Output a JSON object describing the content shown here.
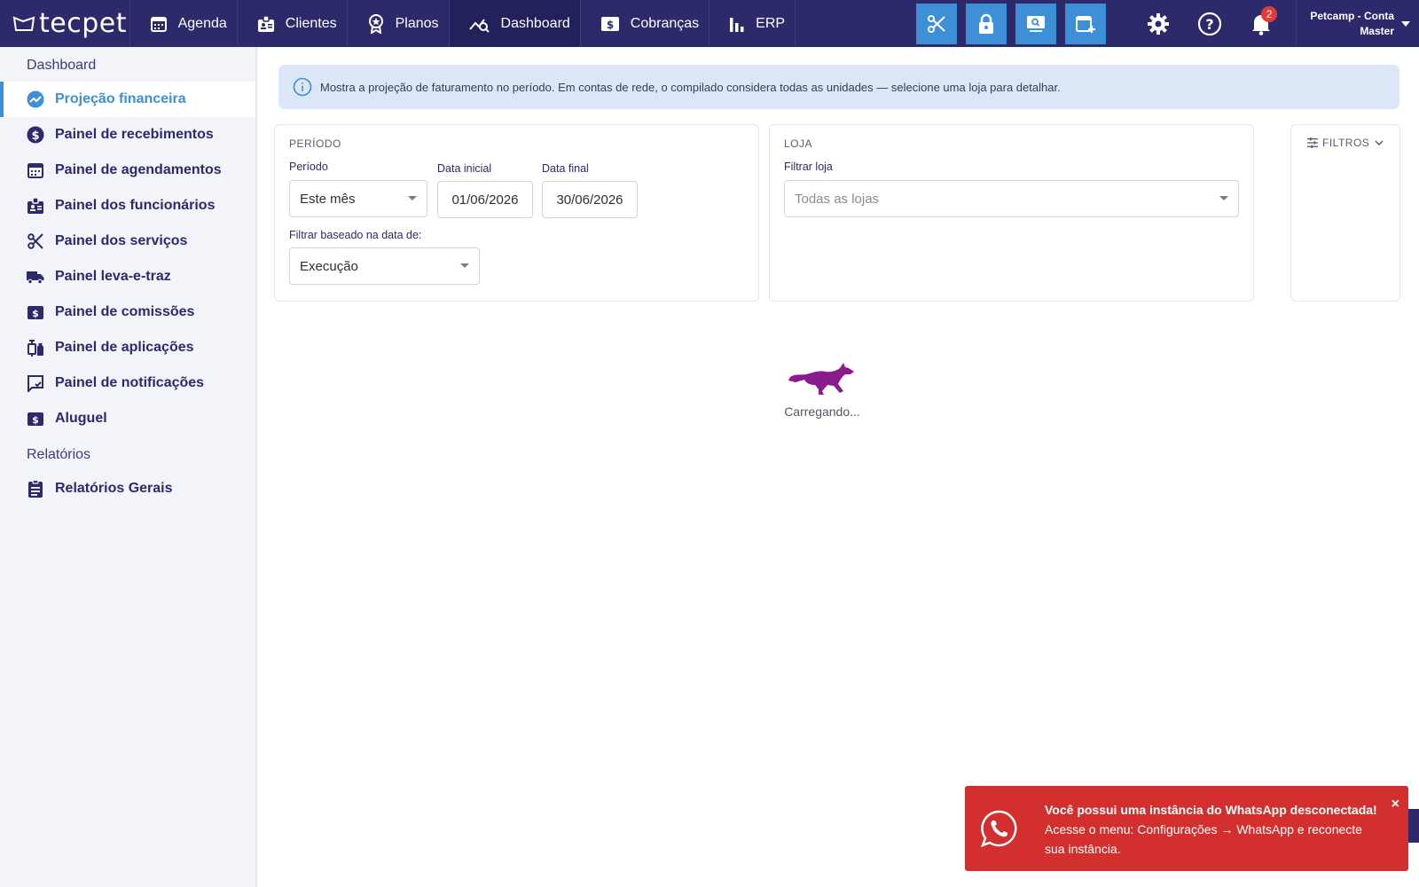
{
  "app": {
    "logo_text": "tecpet"
  },
  "nav": {
    "items": [
      {
        "label": "Agenda",
        "icon": "calendar-icon"
      },
      {
        "label": "Clientes",
        "icon": "badge-icon"
      },
      {
        "label": "Planos",
        "icon": "award-icon"
      },
      {
        "label": "Dashboard",
        "icon": "chart-search-icon"
      },
      {
        "label": "Cobranças",
        "icon": "dollar-card-icon"
      },
      {
        "label": "ERP",
        "icon": "bar-chart-icon"
      }
    ],
    "active": "Dashboard"
  },
  "tools": [
    {
      "icon": "scissors-icon"
    },
    {
      "icon": "lock-icon"
    },
    {
      "icon": "monitor-search-icon"
    },
    {
      "icon": "calendar-plus-icon"
    }
  ],
  "utilities": {
    "notifications_count": "2"
  },
  "account": {
    "line1": "Petcamp - Conta",
    "line2": "Master"
  },
  "sidebar": {
    "section_dashboard": "Dashboard",
    "items": [
      {
        "label": "Projeção financeira",
        "icon": "trend-icon"
      },
      {
        "label": "Painel de recebimentos",
        "icon": "dollar-circle-icon"
      },
      {
        "label": "Painel de agendamentos",
        "icon": "calendar-icon"
      },
      {
        "label": "Painel dos funcionários",
        "icon": "badge-icon"
      },
      {
        "label": "Painel dos serviços",
        "icon": "scissors-icon"
      },
      {
        "label": "Painel leva-e-traz",
        "icon": "truck-icon"
      },
      {
        "label": "Painel de comissões",
        "icon": "dollar-square-icon"
      },
      {
        "label": "Painel de aplicações",
        "icon": "syringe-icon"
      },
      {
        "label": "Painel de notificações",
        "icon": "message-check-icon"
      },
      {
        "label": "Aluguel",
        "icon": "dollar-square-icon"
      }
    ],
    "section_reports": "Relatórios",
    "report_items": [
      {
        "label": "Relatórios Gerais",
        "icon": "clipboard-icon"
      }
    ]
  },
  "banner": {
    "text": "Mostra a projeção de faturamento no período. Em contas de rede, o compilado considera todas as unidades — selecione uma loja para detalhar."
  },
  "period_card": {
    "title": "PERÍODO",
    "period_label": "Período",
    "period_value": "Este mês",
    "start_label": "Data inicial",
    "start_value": "01/06/2026",
    "end_label": "Data final",
    "end_value": "30/06/2026",
    "basis_label": "Filtrar baseado na data de:",
    "basis_value": "Execução"
  },
  "store_card": {
    "title": "LOJA",
    "store_label": "Filtrar loja",
    "store_placeholder": "Todas as lojas"
  },
  "filters": {
    "label": "FILTROS"
  },
  "loading": {
    "text": "Carregando..."
  },
  "toast": {
    "title": "Você possui uma instância do WhatsApp desconectada!",
    "line2": "Acesse o menu: Configurações → WhatsApp e reconecte",
    "line3": "sua instância.",
    "close": "×"
  },
  "colors": {
    "navy": "#2c2a6b",
    "accent": "#3d8fd8",
    "danger": "#d32f2f",
    "loader": "#8b1a8f"
  }
}
